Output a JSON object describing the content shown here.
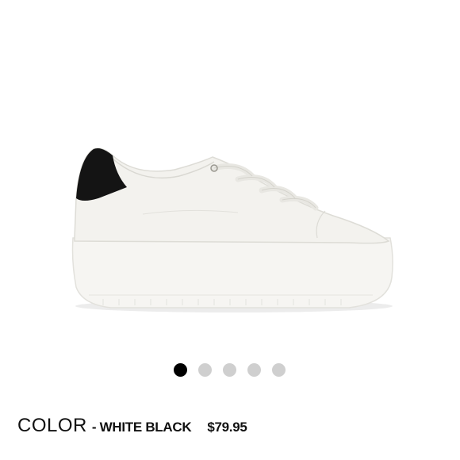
{
  "product": {
    "image_alt_icon": "sneaker-image",
    "upper_color": "#f4f3ef",
    "sole_color": "#f7f6f3",
    "heel_tab_color": "#141414"
  },
  "carousel": {
    "dots": [
      {
        "active": true
      },
      {
        "active": false
      },
      {
        "active": false
      },
      {
        "active": false
      },
      {
        "active": false
      }
    ],
    "active_color": "#000000",
    "inactive_color": "#cfcfcf"
  },
  "info": {
    "color_label": "COLOR",
    "color_value": "- WHITE BLACK",
    "price": "$79.95"
  }
}
